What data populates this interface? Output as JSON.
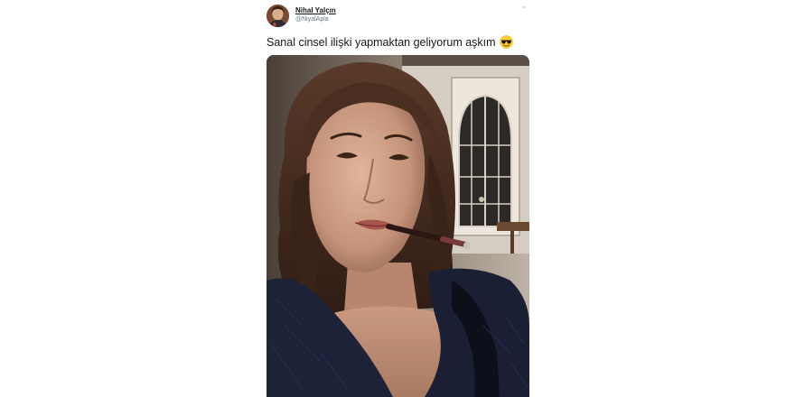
{
  "tweet": {
    "author_name": "Nihal Yalçın",
    "author_handle": "@NiyalApla",
    "more_icon": "more-dots-icon",
    "text": "Sanal cinsel ilişki yapmaktan geliyorum aşkım",
    "emoji": "smiling-face-with-sunglasses",
    "photo": {
      "icon": "photo-selfie"
    }
  },
  "colors": {
    "name": "#14171a",
    "handle": "#657786",
    "background": "#ffffff"
  }
}
